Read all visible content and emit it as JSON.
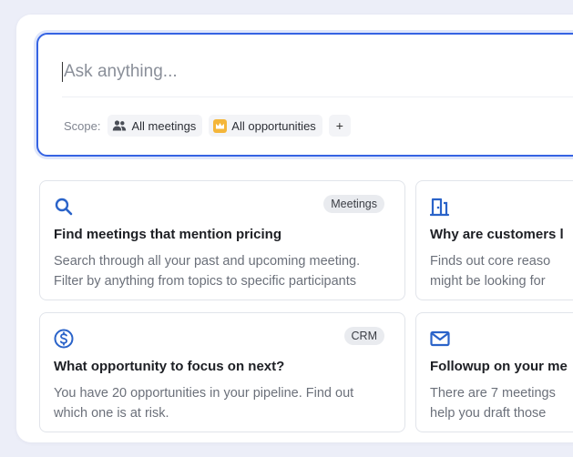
{
  "ask": {
    "placeholder": "Ask anything...",
    "scope_label": "Scope:",
    "chips": [
      {
        "label": "All meetings",
        "icon": "people-icon"
      },
      {
        "label": "All opportunities",
        "icon": "crown-icon"
      }
    ],
    "add_label": "+"
  },
  "suggestions": [
    {
      "icon": "search-icon",
      "badge": "Meetings",
      "title": "Find meetings that mention pricing",
      "description": "Search through all your past and upcoming meeting.\nFilter by  anything from topics to specific participants"
    },
    {
      "icon": "door-exit-icon",
      "badge": "",
      "title": "Why are customers l",
      "description": "Finds out core reaso\nmight be looking for"
    },
    {
      "icon": "dollar-icon",
      "badge": "CRM",
      "title": "What opportunity to focus on next?",
      "description": "You have 20 opportunities in your pipeline. Find out\nwhich one is at risk."
    },
    {
      "icon": "mail-icon",
      "badge": "",
      "title": "Followup on your me",
      "description": "There are 7 meetings\nhelp you draft those"
    }
  ],
  "colors": {
    "accent": "#3563e3",
    "icon_blue": "#2a63c9",
    "crown_bg": "#f4b63a",
    "background": "#eceef8"
  }
}
